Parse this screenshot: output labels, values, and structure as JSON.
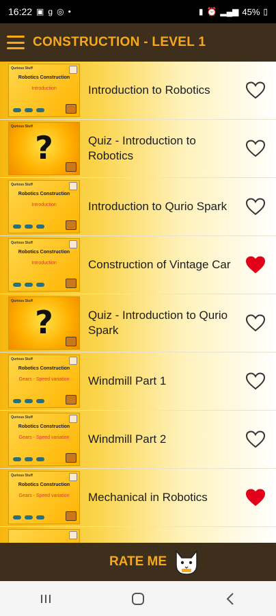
{
  "status_bar": {
    "time": "16:22",
    "battery": "45%"
  },
  "app_bar": {
    "title": "CONSTRUCTION - LEVEL 1",
    "menu_icon": "hamburger-menu-icon"
  },
  "thumbnail_text": {
    "logo": "Qurious Stuff",
    "title": "Robotics Construction",
    "intro": "Introduction",
    "gears": "Gears - Speed variation",
    "quiz_glyph": "?"
  },
  "lessons": [
    {
      "label": "Introduction to Robotics",
      "thumb": "intro",
      "favorite": false
    },
    {
      "label": "Quiz - Introduction to Robotics",
      "thumb": "quiz",
      "favorite": false
    },
    {
      "label": "Introduction to Qurio Spark",
      "thumb": "intro",
      "favorite": false
    },
    {
      "label": "Construction of Vintage Car",
      "thumb": "intro",
      "favorite": true
    },
    {
      "label": "Quiz - Introduction to Qurio Spark",
      "thumb": "quiz",
      "favorite": false
    },
    {
      "label": "Windmill Part 1",
      "thumb": "gears",
      "favorite": false
    },
    {
      "label": "Windmill Part 2",
      "thumb": "gears",
      "favorite": false
    },
    {
      "label": "Mechanical in Robotics",
      "thumb": "gears",
      "favorite": true
    }
  ],
  "rate_bar": {
    "label": "RATE ME",
    "icon": "cat-mascot-icon"
  },
  "colors": {
    "bar_bg": "#3e2e1c",
    "accent": "#f7a81b",
    "heart_filled": "#e3001b",
    "heart_outline": "#333333"
  }
}
